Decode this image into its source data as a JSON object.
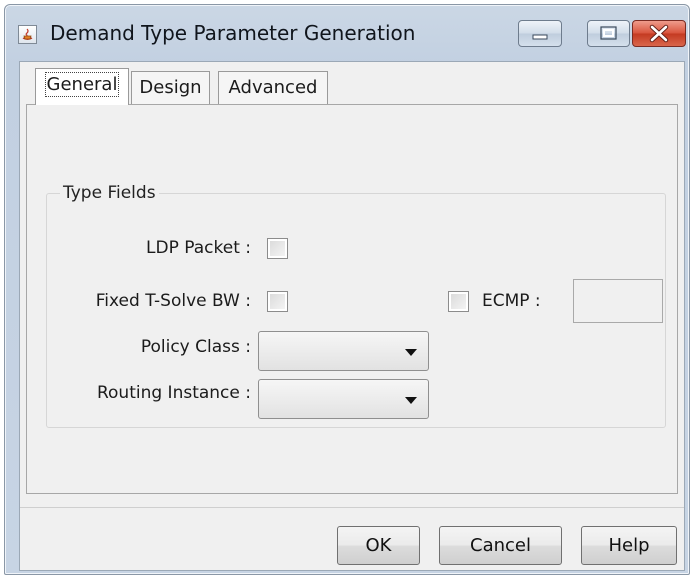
{
  "window": {
    "title": "Demand Type Parameter Generation",
    "icon": "java-app-icon",
    "controls": [
      "minimize-icon",
      "maximize-icon",
      "close-icon"
    ],
    "accent": "#c2d0e1",
    "close_color": "#d9553e"
  },
  "tabs": [
    {
      "label": "General",
      "selected": true
    },
    {
      "label": "Design",
      "selected": false
    },
    {
      "label": "Advanced",
      "selected": false
    }
  ],
  "type_fields": {
    "legend": "Type Fields",
    "ldp_packet": {
      "label": "LDP Packet :",
      "checked": false
    },
    "fixed_tsolve_bw": {
      "label": "Fixed T-Solve BW :",
      "checked": false
    },
    "ecmp": {
      "label": "ECMP :",
      "checked": false,
      "value": ""
    },
    "policy_class": {
      "label": "Policy Class :",
      "selected": ""
    },
    "routing_instance": {
      "label": "Routing Instance :",
      "selected": ""
    }
  },
  "buttons": {
    "ok": "OK",
    "cancel": "Cancel",
    "help": "Help"
  }
}
